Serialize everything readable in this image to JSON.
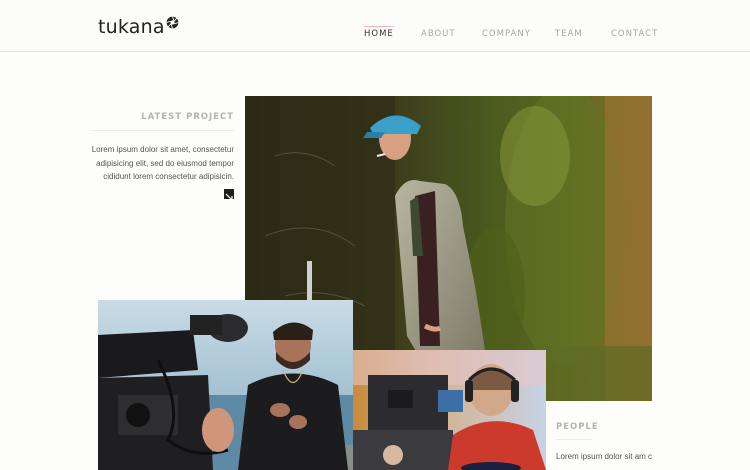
{
  "header": {
    "logo_text": "tukana",
    "nav": [
      {
        "label": "HOME",
        "active": true
      },
      {
        "label": "ABOUT",
        "active": false
      },
      {
        "label": "COMPANY",
        "active": false
      },
      {
        "label": "TEAM",
        "active": false
      },
      {
        "label": "CONTACT",
        "active": false
      }
    ]
  },
  "latest_project": {
    "heading": "LATEST PROJECT",
    "description": "Lorem ipsum dolor sit amet, consectetur adipisicing elit, sed do eiusmod tempor cididunt lorem consectetur adipisicin.",
    "link_icon": "arrow-diagonal-icon"
  },
  "gallery": {
    "main_photo": "man-in-cap-smoking-photo",
    "camera_photo": "video-camera-interview-photo",
    "studio_photo": "camera-operator-headphones-photo"
  },
  "people": {
    "heading": "PEOPLE",
    "description": "Lorem ipsum dolor sit am consectetur adipisicing e"
  },
  "colors": {
    "accent_underline": "#f0b8b8",
    "text_muted": "#a6a6a6",
    "text_dark": "#333333"
  }
}
